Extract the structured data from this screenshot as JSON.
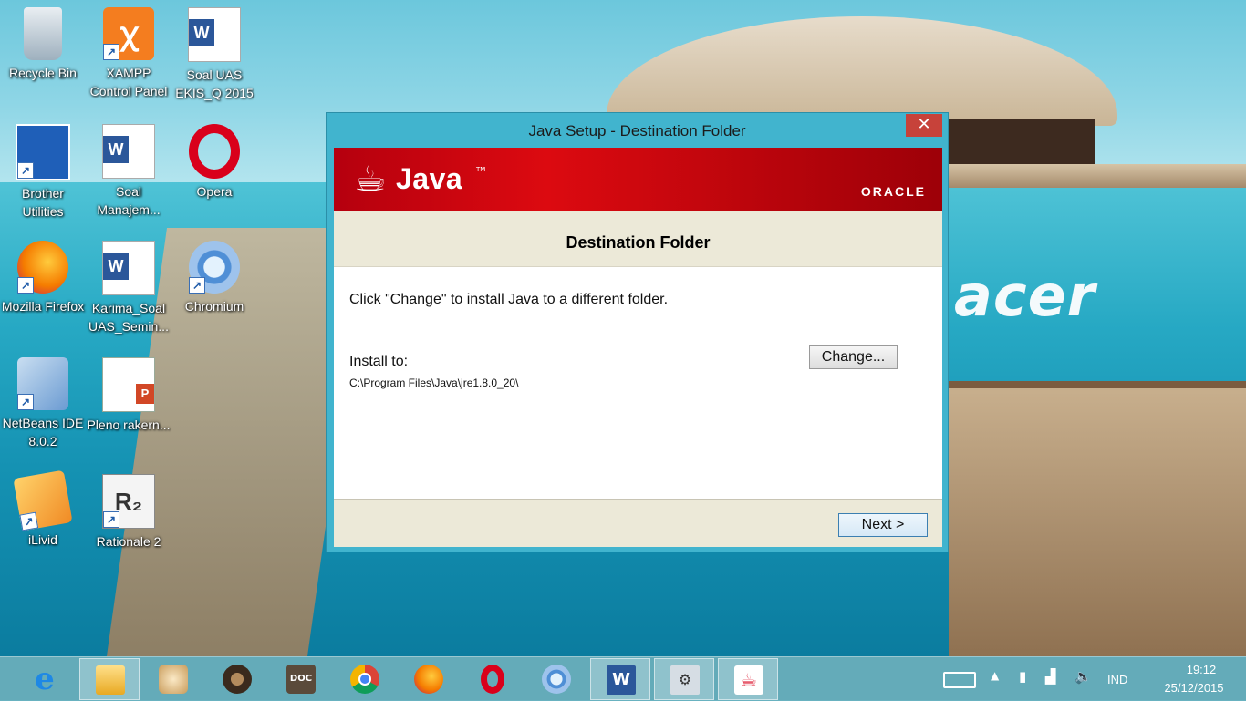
{
  "desktop": {
    "icons": [
      {
        "label": "Recycle Bin",
        "icon": "recycle-bin-icon"
      },
      {
        "label": "XAMPP Control Panel",
        "icon": "xampp-icon"
      },
      {
        "label": "Soal UAS EKIS_Q 2015",
        "icon": "word-document-icon"
      },
      {
        "label": "Brother Utilities",
        "icon": "brother-utilities-icon"
      },
      {
        "label": "Soal Manajem...",
        "icon": "word-document-icon"
      },
      {
        "label": "Opera",
        "icon": "opera-icon"
      },
      {
        "label": "Mozilla Firefox",
        "icon": "firefox-icon"
      },
      {
        "label": "Karima_Soal UAS_Semin...",
        "icon": "word-document-icon"
      },
      {
        "label": "Chromium",
        "icon": "chromium-icon"
      },
      {
        "label": "NetBeans IDE 8.0.2",
        "icon": "netbeans-icon"
      },
      {
        "label": "Pleno rakern...",
        "icon": "powerpoint-document-icon"
      },
      {
        "label": "iLivid",
        "icon": "ilivid-icon"
      },
      {
        "label": "Rationale 2",
        "icon": "rationale-icon"
      }
    ],
    "wallpaper_brand": "acer"
  },
  "dialog": {
    "title": "Java Setup - Destination Folder",
    "close_glyph": "✕",
    "banner": {
      "java_text": "Java",
      "tm": "TM",
      "oracle_text": "ORACLE"
    },
    "page_title": "Destination Folder",
    "instruction": "Click \"Change\" to install Java to a different folder.",
    "install_label": "Install to:",
    "install_path": "C:\\Program Files\\Java\\jre1.8.0_20\\",
    "change_button": "Change...",
    "next_button": "Next >",
    "colors": {
      "banner_red": "#dc0a10",
      "frame": "#41b4ce",
      "close": "#c7423a"
    }
  },
  "taskbar": {
    "items": [
      {
        "name": "internet-explorer",
        "icon": "internet-explorer-icon",
        "glyph": "e"
      },
      {
        "name": "file-explorer",
        "icon": "file-explorer-icon",
        "glyph": ""
      },
      {
        "name": "photo-app",
        "icon": "photo-app-icon",
        "glyph": ""
      },
      {
        "name": "audio-app",
        "icon": "speaker-icon",
        "glyph": ""
      },
      {
        "name": "doc-app",
        "icon": "doc-icon",
        "glyph": "DOC"
      },
      {
        "name": "chrome",
        "icon": "chrome-icon",
        "glyph": ""
      },
      {
        "name": "firefox",
        "icon": "firefox-icon",
        "glyph": ""
      },
      {
        "name": "opera",
        "icon": "opera-icon",
        "glyph": ""
      },
      {
        "name": "chromium",
        "icon": "chromium-icon",
        "glyph": ""
      },
      {
        "name": "word",
        "icon": "word-icon",
        "glyph": "W"
      },
      {
        "name": "setup",
        "icon": "setup-icon",
        "glyph": "⚙"
      },
      {
        "name": "java-setup",
        "icon": "java-icon",
        "glyph": "☕"
      }
    ],
    "tray": {
      "language": "IND",
      "time": "19:12",
      "date": "25/12/2015"
    }
  }
}
